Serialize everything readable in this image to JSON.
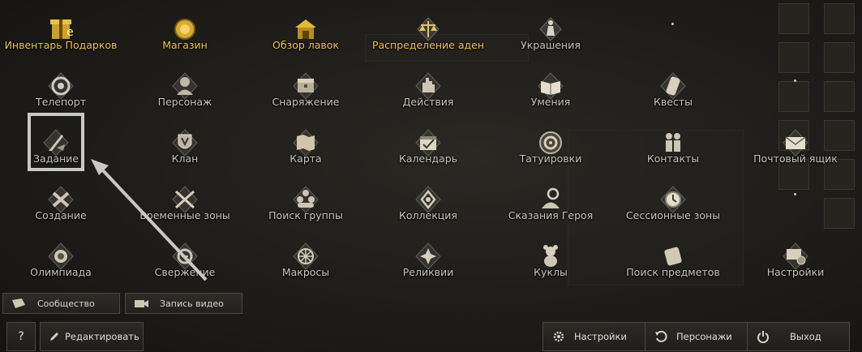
{
  "colors": {
    "gold": "#f2c744",
    "text": "#c9c6bf",
    "highlight": "#c8c8c6"
  },
  "menu": {
    "row1": [
      {
        "label": "Инвентарь Подарков",
        "icon": "gift-icon",
        "gold": true
      },
      {
        "label": "Магазин",
        "icon": "shop-coin-icon",
        "gold": true
      },
      {
        "label": "Обзор лавок",
        "icon": "stall-icon",
        "gold": true
      },
      {
        "label": "Распределение аден",
        "icon": "scales-icon",
        "gold": true
      },
      {
        "label": "Украшения",
        "icon": "chess-piece-icon",
        "gold": false
      }
    ],
    "row2": [
      {
        "label": "Телепорт",
        "icon": "portal-icon"
      },
      {
        "label": "Персонаж",
        "icon": "character-icon"
      },
      {
        "label": "Снаряжение",
        "icon": "chest-icon"
      },
      {
        "label": "Действия",
        "icon": "hand-icon"
      },
      {
        "label": "Умения",
        "icon": "book-icon"
      },
      {
        "label": "Квесты",
        "icon": "scroll-icon"
      }
    ],
    "row3": [
      {
        "label": "Задание",
        "icon": "quill-icon"
      },
      {
        "label": "Клан",
        "icon": "clan-shield-icon"
      },
      {
        "label": "Карта",
        "icon": "map-icon"
      },
      {
        "label": "Календарь",
        "icon": "calendar-icon"
      },
      {
        "label": "Татуировки",
        "icon": "tattoo-icon"
      },
      {
        "label": "Контакты",
        "icon": "contacts-icon"
      },
      {
        "label": "Почтовый ящик",
        "icon": "mail-icon"
      }
    ],
    "row4": [
      {
        "label": "Создание",
        "icon": "crafting-icon"
      },
      {
        "label": "Временные зоны",
        "icon": "crossed-swords-icon"
      },
      {
        "label": "Поиск группы",
        "icon": "group-icon"
      },
      {
        "label": "Коллекция",
        "icon": "collection-icon"
      },
      {
        "label": "Сказания Героя",
        "icon": "hero-icon"
      },
      {
        "label": "Сессионные зоны",
        "icon": "session-zone-icon"
      }
    ],
    "row5": [
      {
        "label": "Олимпиада",
        "icon": "olympiad-icon"
      },
      {
        "label": "Свержение",
        "icon": "overthrow-icon"
      },
      {
        "label": "Макросы",
        "icon": "macro-icon"
      },
      {
        "label": "Реликвии",
        "icon": "relic-icon"
      },
      {
        "label": "Куклы",
        "icon": "doll-icon"
      },
      {
        "label": "Поиск предметов",
        "icon": "item-search-icon"
      },
      {
        "label": "Настройки",
        "icon": "settings-monitor-icon"
      }
    ]
  },
  "bar": {
    "community": "Сообщество",
    "record_video": "Запись видео"
  },
  "bottom": {
    "help": "?",
    "edit": "Редактировать",
    "settings": "Настройки",
    "characters": "Персонажи",
    "exit": "Выход"
  }
}
